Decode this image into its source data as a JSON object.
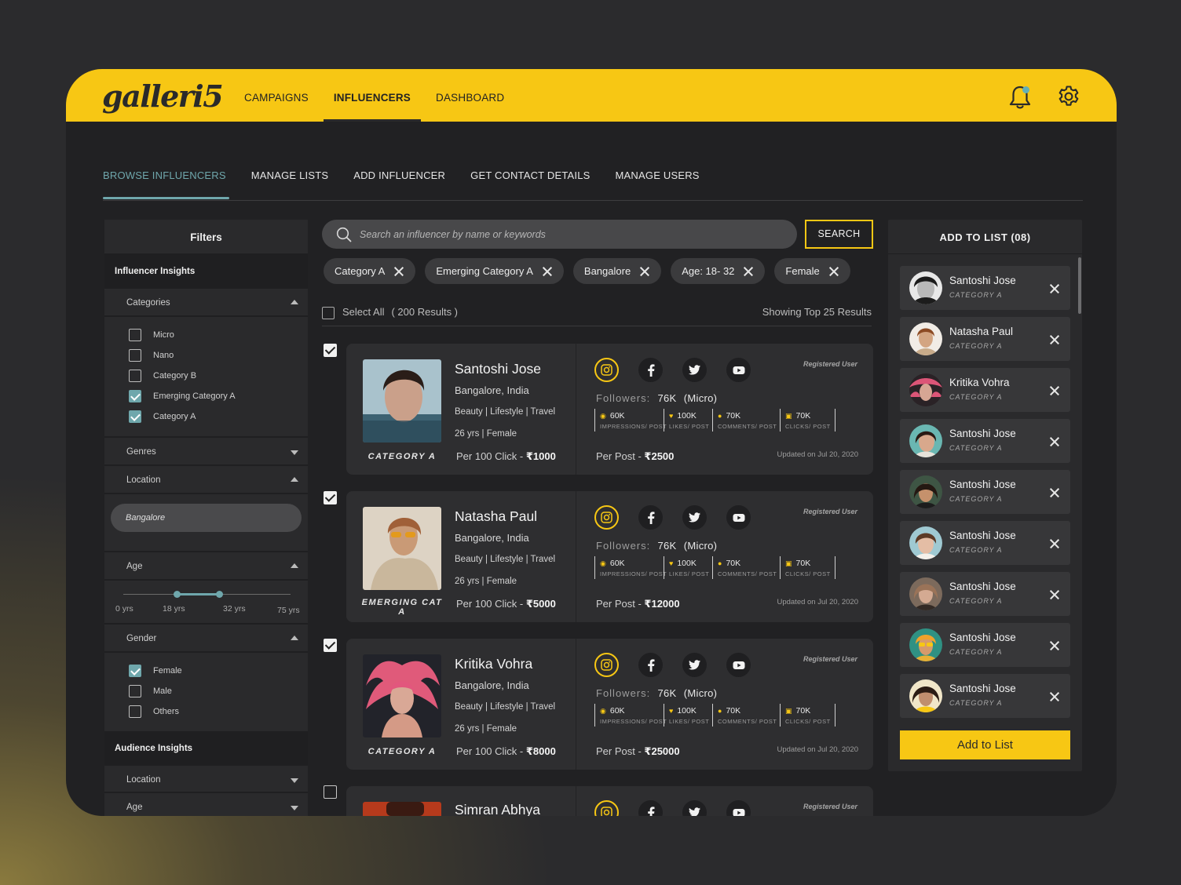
{
  "app": {
    "logo": "galleri5"
  },
  "topnav": [
    {
      "label": "CAMPAIGNS",
      "active": false
    },
    {
      "label": "INFLUENCERS",
      "active": true
    },
    {
      "label": "DASHBOARD",
      "active": false
    }
  ],
  "subtabs": [
    {
      "label": "BROWSE INFLUENCERS",
      "active": true
    },
    {
      "label": "MANAGE LISTS"
    },
    {
      "label": "ADD INFLUENCER"
    },
    {
      "label": "GET CONTACT DETAILS"
    },
    {
      "label": "MANAGE USERS"
    }
  ],
  "filters": {
    "title": "Filters",
    "influencer_insights": "Influencer Insights",
    "categories_label": "Categories",
    "categories": [
      {
        "label": "Micro",
        "checked": false
      },
      {
        "label": "Nano",
        "checked": false
      },
      {
        "label": "Category B",
        "checked": false
      },
      {
        "label": "Emerging Category A",
        "checked": true
      },
      {
        "label": "Category A",
        "checked": true
      }
    ],
    "genres_label": "Genres",
    "location_label": "Location",
    "location_value": "Bangalore",
    "age_label": "Age",
    "age_ticks": [
      "0 yrs",
      "18 yrs",
      "32 yrs",
      "75 yrs"
    ],
    "gender_label": "Gender",
    "genders": [
      {
        "label": "Female",
        "checked": true
      },
      {
        "label": "Male",
        "checked": false
      },
      {
        "label": "Others",
        "checked": false
      }
    ],
    "audience_insights": "Audience Insights",
    "aud_location_label": "Location",
    "aud_age_label": "Age"
  },
  "search": {
    "placeholder": "Search an influencer by name or keywords",
    "button": "SEARCH"
  },
  "chips": [
    "Category A",
    "Emerging Category A",
    "Bangalore",
    "Age: 18- 32",
    "Female"
  ],
  "results": {
    "select_all": "Select All",
    "count": "( 200 Results )",
    "showing": "Showing Top 25 Results"
  },
  "cards": [
    {
      "checked": true,
      "name": "Santoshi Jose",
      "city": "Bangalore, India",
      "tags": "Beauty | Lifestyle | Travel",
      "age_gender": "26 yrs | Female",
      "category": "CATEGORY A",
      "click_prefix": "Per 100 Click - ",
      "click_price": "₹1000",
      "registered": "Registered User",
      "followers_label": "Followers:",
      "followers": "76K",
      "tier": "(Micro)",
      "stats": [
        {
          "icon": "eye-icon",
          "value": "60K",
          "label": "IMPRESSIONS/ POST"
        },
        {
          "icon": "heart-icon",
          "value": "100K",
          "label": "LIKES/ POST"
        },
        {
          "icon": "comment-icon",
          "value": "70K",
          "label": "COMMENTS/ POST"
        },
        {
          "icon": "click-icon",
          "value": "70K",
          "label": "CLICKS/ POST"
        }
      ],
      "post_prefix": "Per Post - ",
      "post_price": "₹2500",
      "updated": "Updated on Jul 20, 2020"
    },
    {
      "checked": true,
      "name": "Natasha Paul",
      "city": "Bangalore, India",
      "tags": "Beauty | Lifestyle | Travel",
      "age_gender": "26 yrs | Female",
      "category": "EMERGING CAT A",
      "click_prefix": "Per 100 Click - ",
      "click_price": "₹5000",
      "registered": "Registered User",
      "followers_label": "Followers:",
      "followers": "76K",
      "tier": "(Micro)",
      "stats": [
        {
          "icon": "eye-icon",
          "value": "60K",
          "label": "IMPRESSIONS/ POST"
        },
        {
          "icon": "heart-icon",
          "value": "100K",
          "label": "LIKES/ POST"
        },
        {
          "icon": "comment-icon",
          "value": "70K",
          "label": "COMMENTS/ POST"
        },
        {
          "icon": "click-icon",
          "value": "70K",
          "label": "CLICKS/ POST"
        }
      ],
      "post_prefix": "Per Post - ",
      "post_price": "₹12000",
      "updated": "Updated on Jul 20, 2020"
    },
    {
      "checked": true,
      "name": "Kritika Vohra",
      "city": "Bangalore, India",
      "tags": "Beauty | Lifestyle | Travel",
      "age_gender": "26 yrs | Female",
      "category": "CATEGORY A",
      "click_prefix": "Per 100 Click - ",
      "click_price": "₹8000",
      "registered": "Registered User",
      "followers_label": "Followers:",
      "followers": "76K",
      "tier": "(Micro)",
      "stats": [
        {
          "icon": "eye-icon",
          "value": "60K",
          "label": "IMPRESSIONS/ POST"
        },
        {
          "icon": "heart-icon",
          "value": "100K",
          "label": "LIKES/ POST"
        },
        {
          "icon": "comment-icon",
          "value": "70K",
          "label": "COMMENTS/ POST"
        },
        {
          "icon": "click-icon",
          "value": "70K",
          "label": "CLICKS/ POST"
        }
      ],
      "post_prefix": "Per Post - ",
      "post_price": "₹25000",
      "updated": "Updated on Jul 20, 2020"
    },
    {
      "checked": false,
      "name": "Simran Abhya",
      "registered": "Registered User"
    }
  ],
  "add_to_list": {
    "title": "ADD TO LIST (08)",
    "items": [
      {
        "name": "Santoshi Jose",
        "category": "CATEGORY A"
      },
      {
        "name": "Natasha Paul",
        "category": "CATEGORY A"
      },
      {
        "name": "Kritika Vohra",
        "category": "CATEGORY A"
      },
      {
        "name": "Santoshi Jose",
        "category": "CATEGORY A"
      },
      {
        "name": "Santoshi Jose",
        "category": "CATEGORY A"
      },
      {
        "name": "Santoshi Jose",
        "category": "CATEGORY A"
      },
      {
        "name": "Santoshi Jose",
        "category": "CATEGORY A"
      },
      {
        "name": "Santoshi Jose",
        "category": "CATEGORY A"
      },
      {
        "name": "Santoshi Jose",
        "category": "CATEGORY A"
      }
    ],
    "button": "Add to List"
  },
  "colors": {
    "brand_yellow": "#f7c714",
    "accent_teal": "#6fa7ac",
    "panel": "#2a2a2c",
    "card": "#2e2e30"
  }
}
